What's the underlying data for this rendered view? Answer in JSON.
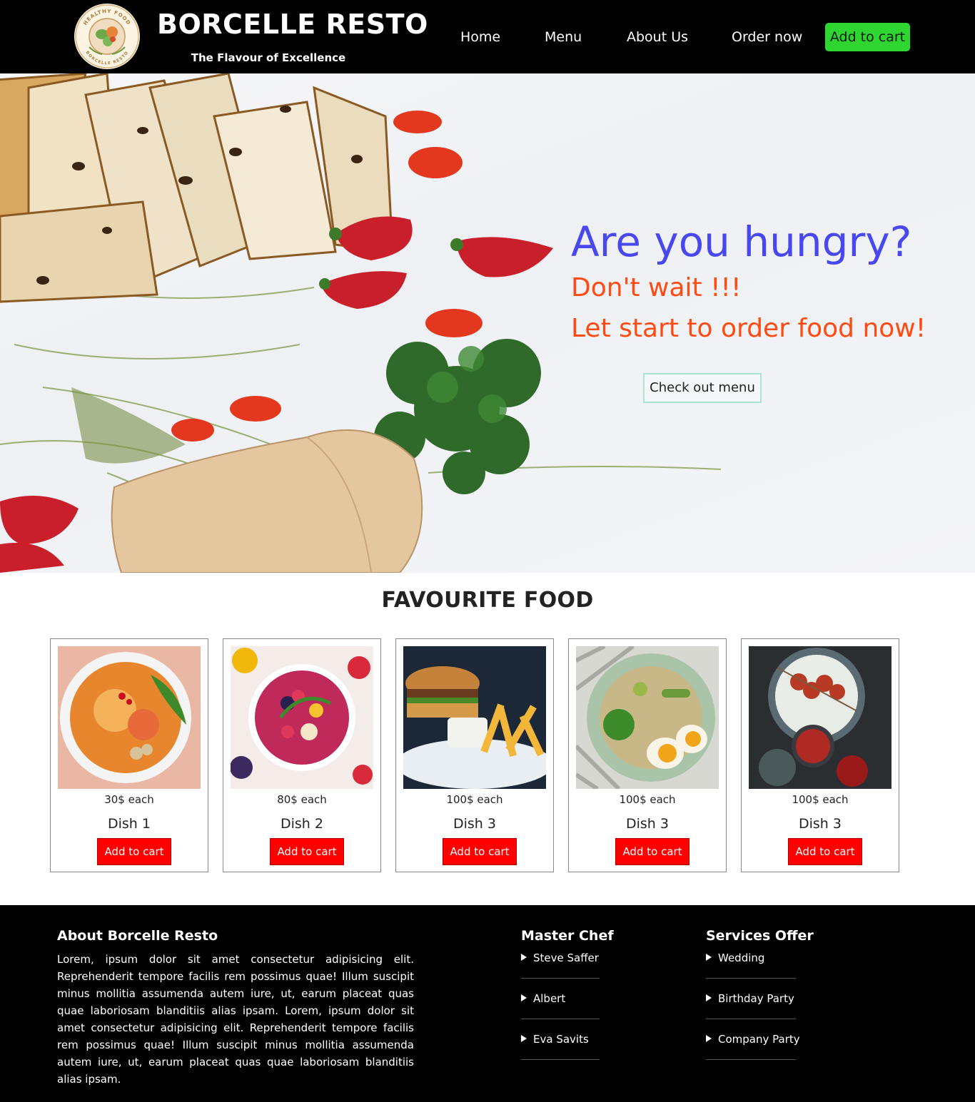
{
  "nav": {
    "logo_ring_top": "HEALTHY FOOD",
    "logo_ring_bottom": "BORCELLE RESTO",
    "brand": "BORCELLE RESTO",
    "tagline": "The Flavour of Excellence",
    "links": [
      "Home",
      "Menu",
      "About Us",
      "Order now"
    ],
    "cart_label": "Add to cart",
    "cart_color": "#2fd631"
  },
  "hero": {
    "headline": "Are you hungry?",
    "line2": "Don't wait !!!",
    "line3": "Let start to order food now!",
    "cta": "Check out menu",
    "headline_color": "#4848ee",
    "accent_color": "#ff4a12"
  },
  "favourites": {
    "title": "FAVOURITE FOOD",
    "items": [
      {
        "price": "30$ each",
        "name": "Dish 1",
        "button": "Add to cart"
      },
      {
        "price": "80$ each",
        "name": "Dish 2",
        "button": "Add to cart"
      },
      {
        "price": "100$ each",
        "name": "Dish 3",
        "button": "Add to cart"
      },
      {
        "price": "100$ each",
        "name": "Dish 3",
        "button": "Add to cart"
      },
      {
        "price": "100$ each",
        "name": "Dish 3",
        "button": "Add to cart"
      }
    ],
    "button_color": "#ff0000"
  },
  "footer": {
    "about_title": "About Borcelle Resto",
    "about_text": "Lorem, ipsum dolor sit amet consectetur adipisicing elit. Reprehenderit tempore facilis rem possimus quae! Illum suscipit minus mollitia assumenda autem iure, ut, earum placeat quas quae laboriosam blanditiis alias ipsam. Lorem, ipsum dolor sit amet consectetur adipisicing elit. Reprehenderit tempore facilis rem possimus quae! Illum suscipit minus mollitia assumenda autem iure, ut, earum placeat quas quae laboriosam blanditiis alias ipsam.",
    "chef_title": "Master Chef",
    "chefs": [
      "Steve Saffer",
      "Albert",
      "Eva Savits"
    ],
    "services_title": "Services Offer",
    "services": [
      "Wedding",
      "Birthday Party",
      "Company Party"
    ]
  }
}
